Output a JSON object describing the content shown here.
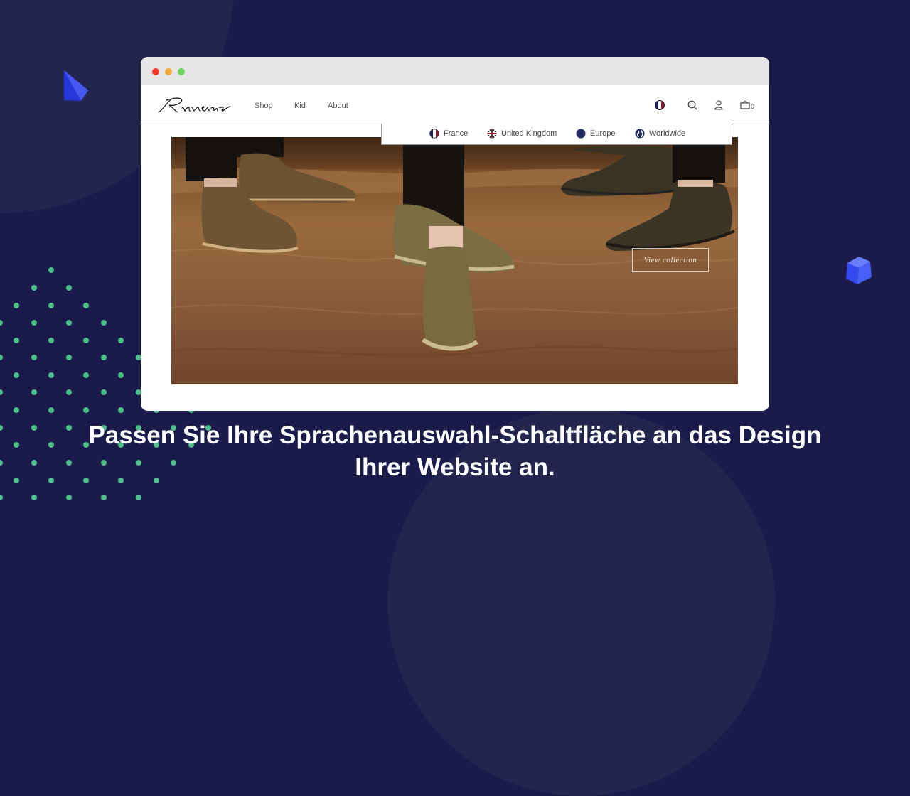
{
  "browser": {
    "traffic_lights": [
      "close",
      "minimize",
      "maximize"
    ]
  },
  "site": {
    "logo_text": "Rivieras",
    "nav": [
      {
        "label": "Shop"
      },
      {
        "label": "Kid"
      },
      {
        "label": "About"
      }
    ],
    "header_icons": [
      "france-flag-icon",
      "search-icon",
      "user-icon",
      "shopping-bag-icon"
    ],
    "cart_count": "0"
  },
  "language_dropdown": {
    "items": [
      {
        "label": "France",
        "icon": "france-flag-icon"
      },
      {
        "label": "United Kingdom",
        "icon": "uk-flag-icon"
      },
      {
        "label": "Europe",
        "icon": "eu-flag-icon"
      },
      {
        "label": "Worldwide",
        "icon": "globe-icon"
      }
    ]
  },
  "hero": {
    "cta_label": "View collection",
    "image_alt": "Suede slip-on boots standing on sand"
  },
  "caption": {
    "line1": "Passen Sie Ihre Sprachenauswahl-Schaltfläche an das Design",
    "line2": "Ihrer Website an."
  },
  "colors": {
    "background": "#1a1a4b",
    "dots": "#4cc08a",
    "accent_shape": "#3047e6"
  }
}
